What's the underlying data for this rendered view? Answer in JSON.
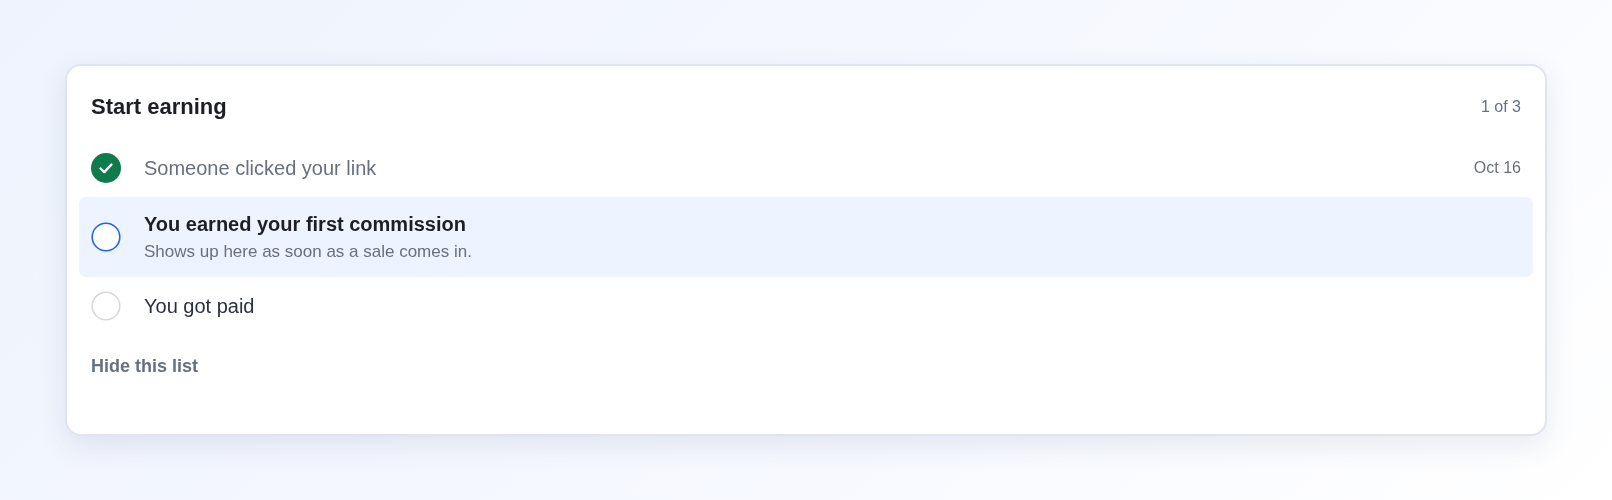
{
  "card": {
    "title": "Start earning",
    "progress": "1 of 3",
    "steps": [
      {
        "label": "Someone clicked your link",
        "done": true,
        "selected": false,
        "date": "Oct 16"
      },
      {
        "label": "You earned your first commission",
        "done": false,
        "selected": true,
        "hint": "Shows up here as soon as a sale comes in."
      },
      {
        "label": "You got paid",
        "done": false,
        "selected": false
      }
    ],
    "hide_link": "Hide this list"
  }
}
